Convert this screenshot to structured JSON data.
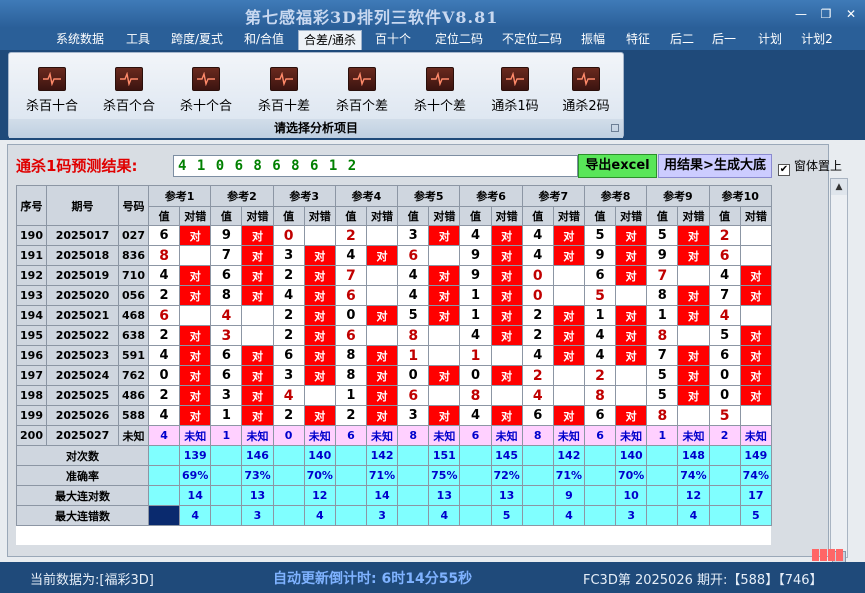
{
  "window": {
    "title": "第七感福彩3D排列三软件V8.81",
    "minimize": "—",
    "restore": "❐",
    "close": "✕"
  },
  "menu": [
    "系统数据",
    "工具",
    "跨度/夏式",
    "和/合值",
    "合差/通杀",
    "百十个",
    "定位二码",
    "不定位二码",
    "振幅",
    "特征",
    "后二",
    "后一",
    "计划",
    "计划2"
  ],
  "menu_active": "合差/通杀",
  "ribbon": {
    "buttons": [
      "杀百十合",
      "杀百个合",
      "杀十个合",
      "杀百十差",
      "杀百个差",
      "杀十个差",
      "通杀1码",
      "通杀2码"
    ],
    "caption": "请选择分析项目"
  },
  "prediction": {
    "label": "通杀1码预测结果:",
    "value": "4 1 0 6 8 6 8 6 1 2",
    "export_label": "导出excel",
    "generate_label": "用结果>生成大底",
    "topmost_label": "窗体置上",
    "topmost_checked": true
  },
  "table": {
    "headers": {
      "seq": "序号",
      "issue": "期号",
      "code": "号码",
      "ref_value": "值",
      "ref_result": "对错"
    },
    "refs": [
      "参考1",
      "参考2",
      "参考3",
      "参考4",
      "参考5",
      "参考6",
      "参考7",
      "参考8",
      "参考9",
      "参考10"
    ],
    "hit_mark": "对",
    "rows": [
      {
        "seq": "190",
        "issue": "2025017",
        "code": "027",
        "vals": [
          "6",
          "9",
          "0",
          "2",
          "3",
          "4",
          "4",
          "5",
          "5",
          "2"
        ],
        "hits": [
          1,
          1,
          0,
          0,
          1,
          1,
          1,
          1,
          1,
          0
        ]
      },
      {
        "seq": "191",
        "issue": "2025018",
        "code": "836",
        "vals": [
          "8",
          "7",
          "3",
          "4",
          "6",
          "9",
          "4",
          "9",
          "9",
          "6"
        ],
        "hits": [
          0,
          1,
          1,
          1,
          0,
          1,
          1,
          1,
          1,
          0
        ]
      },
      {
        "seq": "192",
        "issue": "2025019",
        "code": "710",
        "vals": [
          "4",
          "6",
          "2",
          "7",
          "4",
          "9",
          "0",
          "6",
          "7",
          "4"
        ],
        "hits": [
          1,
          1,
          1,
          0,
          1,
          1,
          0,
          1,
          0,
          1
        ]
      },
      {
        "seq": "193",
        "issue": "2025020",
        "code": "056",
        "vals": [
          "2",
          "8",
          "4",
          "6",
          "4",
          "1",
          "0",
          "5",
          "8",
          "7"
        ],
        "hits": [
          1,
          1,
          1,
          0,
          1,
          1,
          0,
          0,
          1,
          1
        ]
      },
      {
        "seq": "194",
        "issue": "2025021",
        "code": "468",
        "vals": [
          "6",
          "4",
          "2",
          "0",
          "5",
          "1",
          "2",
          "1",
          "1",
          "4"
        ],
        "hits": [
          0,
          0,
          1,
          1,
          1,
          1,
          1,
          1,
          1,
          0
        ]
      },
      {
        "seq": "195",
        "issue": "2025022",
        "code": "638",
        "vals": [
          "2",
          "3",
          "2",
          "6",
          "8",
          "4",
          "2",
          "4",
          "8",
          "5"
        ],
        "hits": [
          1,
          0,
          1,
          0,
          0,
          1,
          1,
          1,
          0,
          1
        ]
      },
      {
        "seq": "196",
        "issue": "2025023",
        "code": "591",
        "vals": [
          "4",
          "6",
          "6",
          "8",
          "1",
          "1",
          "4",
          "4",
          "7",
          "6"
        ],
        "hits": [
          1,
          1,
          1,
          1,
          0,
          0,
          1,
          1,
          1,
          1
        ]
      },
      {
        "seq": "197",
        "issue": "2025024",
        "code": "762",
        "vals": [
          "0",
          "6",
          "3",
          "8",
          "0",
          "0",
          "2",
          "2",
          "5",
          "0"
        ],
        "hits": [
          1,
          1,
          1,
          1,
          1,
          1,
          0,
          0,
          1,
          1
        ]
      },
      {
        "seq": "198",
        "issue": "2025025",
        "code": "486",
        "vals": [
          "2",
          "3",
          "4",
          "1",
          "6",
          "8",
          "4",
          "8",
          "5",
          "0"
        ],
        "hits": [
          1,
          1,
          0,
          1,
          0,
          0,
          0,
          0,
          1,
          1
        ]
      },
      {
        "seq": "199",
        "issue": "2025026",
        "code": "588",
        "vals": [
          "4",
          "1",
          "2",
          "2",
          "3",
          "4",
          "6",
          "6",
          "8",
          "5"
        ],
        "hits": [
          1,
          1,
          1,
          1,
          1,
          1,
          1,
          1,
          0,
          0
        ]
      }
    ],
    "pred_row": {
      "seq": "200",
      "issue": "2025027",
      "code": "未知",
      "vals": [
        "4",
        "1",
        "0",
        "6",
        "8",
        "6",
        "8",
        "6",
        "1",
        "2"
      ],
      "result": "未知"
    },
    "stats": [
      {
        "label": "对次数",
        "vals": [
          "139",
          "146",
          "140",
          "142",
          "151",
          "145",
          "142",
          "140",
          "148",
          "149"
        ]
      },
      {
        "label": "准确率",
        "vals": [
          "69%",
          "73%",
          "70%",
          "71%",
          "75%",
          "72%",
          "71%",
          "70%",
          "74%",
          "74%"
        ]
      },
      {
        "label": "最大连对数",
        "vals": [
          "14",
          "13",
          "12",
          "14",
          "13",
          "13",
          "9",
          "10",
          "12",
          "17"
        ]
      },
      {
        "label": "最大连错数",
        "vals": [
          "4",
          "3",
          "4",
          "3",
          "4",
          "5",
          "4",
          "3",
          "4",
          "5"
        ]
      }
    ]
  },
  "status": {
    "source": "当前数据为:[福彩3D]",
    "timer": "自动更新倒计时: 6时14分55秒",
    "issue": "FC3D第 2025026 期开:【588】【746】"
  }
}
